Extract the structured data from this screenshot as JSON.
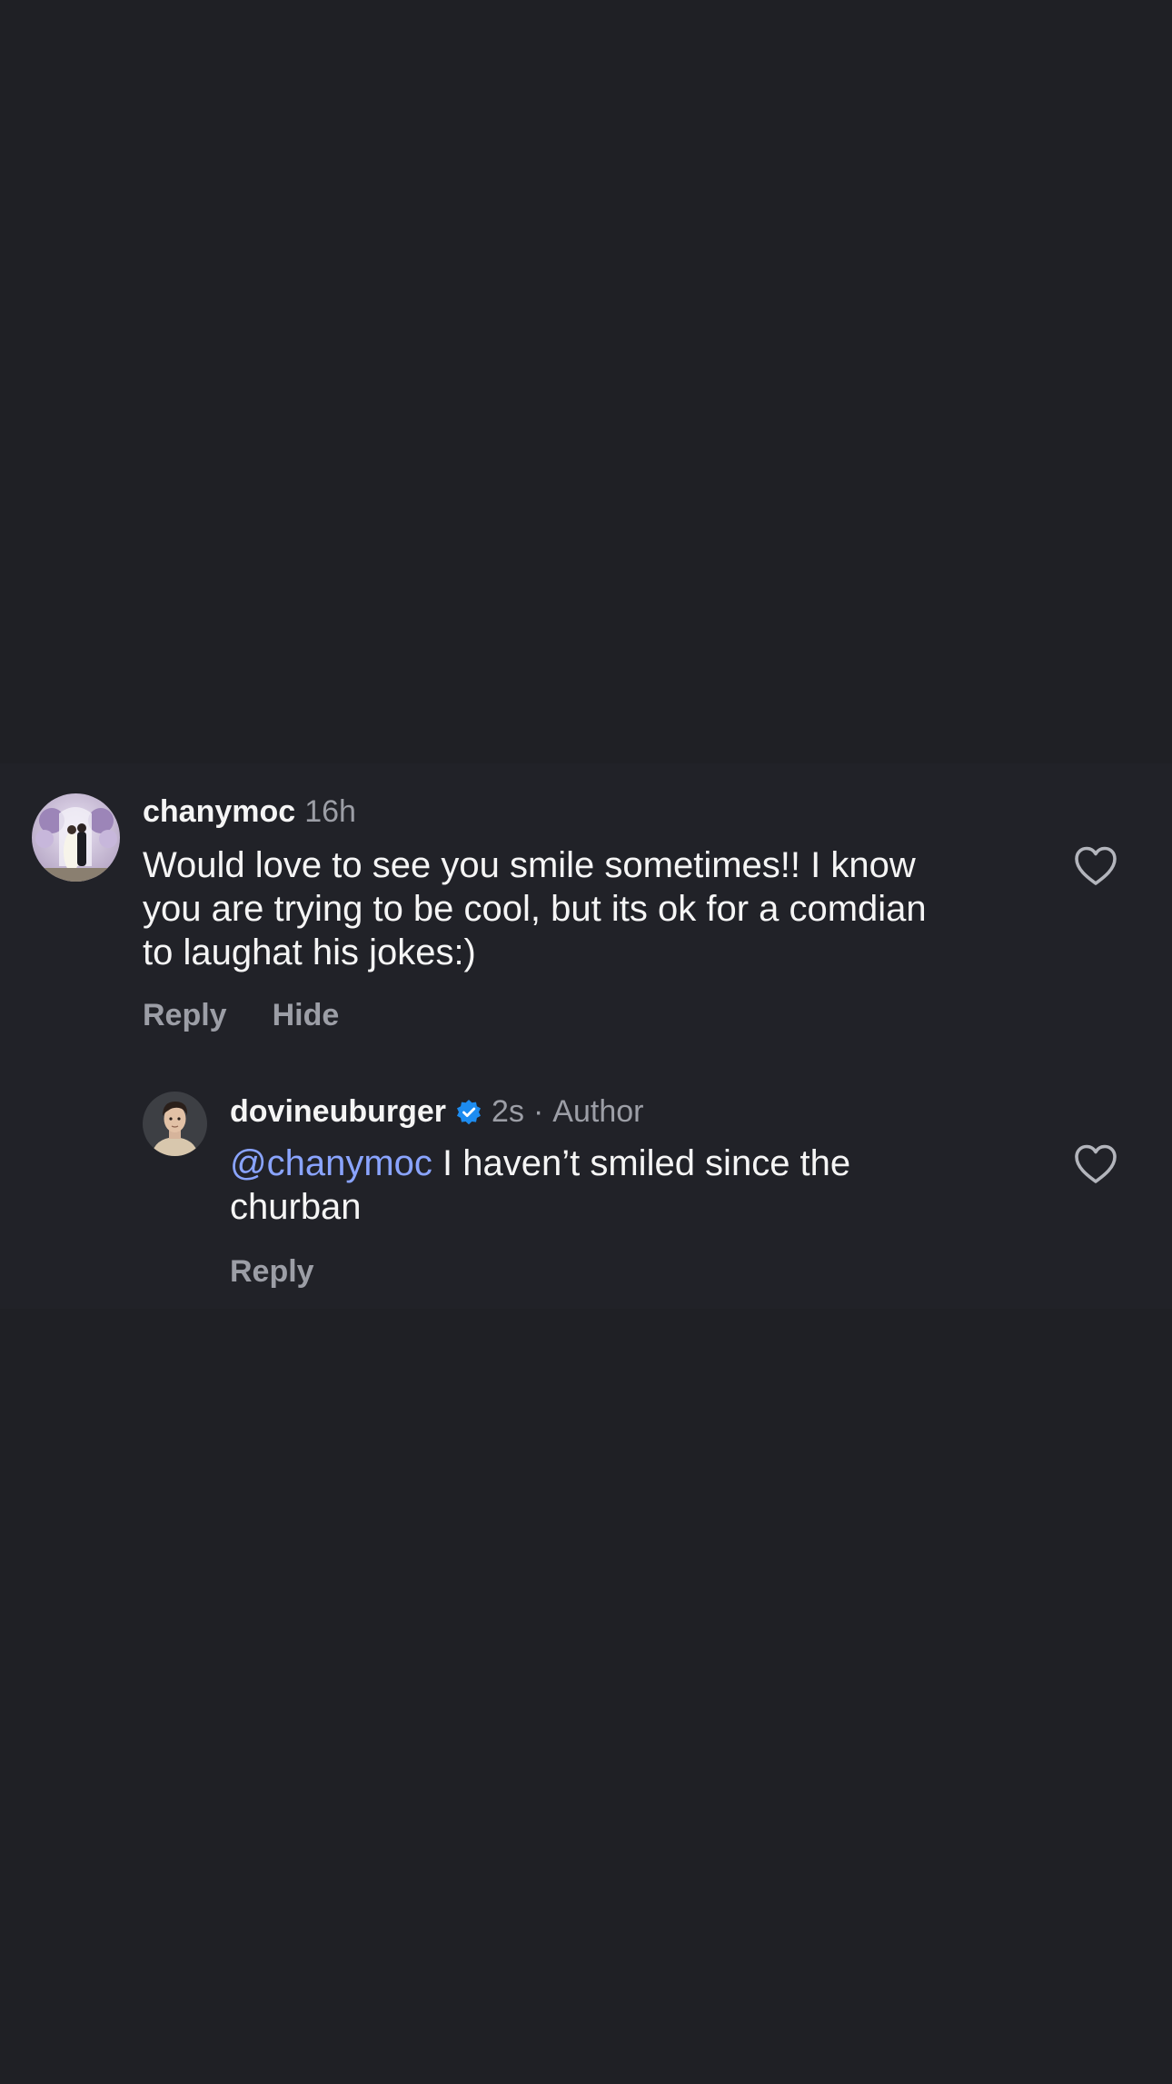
{
  "comments": [
    {
      "username": "chanymoc",
      "time": "16h",
      "text": "Would love to see you smile sometimes!! I know\nyou are trying to be cool, but its ok for a comdian\nto laughat his jokes:)",
      "actions": [
        "Reply",
        "Hide"
      ],
      "like_icon": "heart-outline-icon",
      "avatar_icon": "wedding-photo-avatar"
    }
  ],
  "replies": [
    {
      "username": "dovineuburger",
      "verified": true,
      "time": "2s",
      "separator": "·",
      "badge": "Author",
      "mention": "@chanymoc",
      "text": " I haven’t smiled since the\nchurban",
      "actions": [
        "Reply"
      ],
      "like_icon": "heart-outline-icon",
      "avatar_icon": "man-portrait-avatar"
    }
  ],
  "colors": {
    "background": "#1f2025",
    "text": "#f5f5f5",
    "muted": "#9c9ea6",
    "mention": "#8aa4ff",
    "verified": "#1d8cf0"
  }
}
